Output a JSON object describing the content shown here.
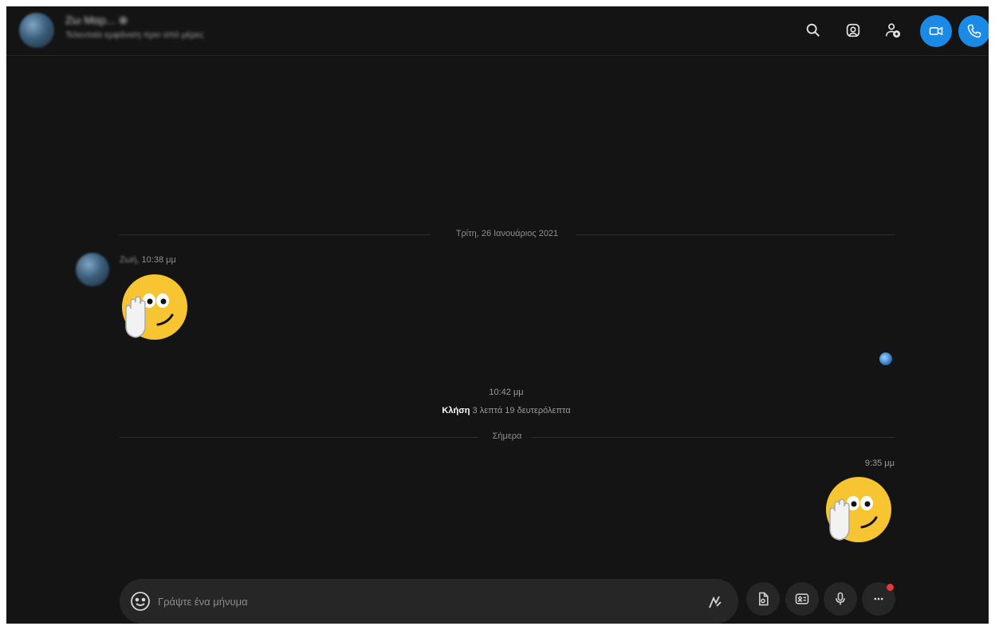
{
  "header": {
    "contact_name": "Ζω Μαρ... ⊕",
    "contact_status": "Τελευταία εμφάνιση πριν από μέρες",
    "icons": [
      "search-icon",
      "gallery-icon",
      "add-person-icon",
      "video-call-icon",
      "audio-call-icon"
    ],
    "accent_color": "#1a8ae6"
  },
  "conversation": {
    "date_divider_1": "Τρίτη, 26 Ιανουάριος 2021",
    "incoming": {
      "sender": "Ζωή,",
      "time": "10:38 μμ",
      "emoji": "wave-emoji"
    },
    "call": {
      "time": "10:42 μμ",
      "label": "Κλήση",
      "duration": "3 λεπτά 19 δευτερόλεπτα"
    },
    "date_divider_2": "Σήμερα",
    "outgoing": {
      "time": "9:35 μμ",
      "emoji": "wave-emoji"
    }
  },
  "composer": {
    "placeholder": "Γράψτε ένα μήνυμα",
    "value": "",
    "tool_icons": [
      "attach-file-icon",
      "contact-card-icon",
      "microphone-icon",
      "more-options-icon"
    ],
    "notification_color": "#e53935"
  }
}
